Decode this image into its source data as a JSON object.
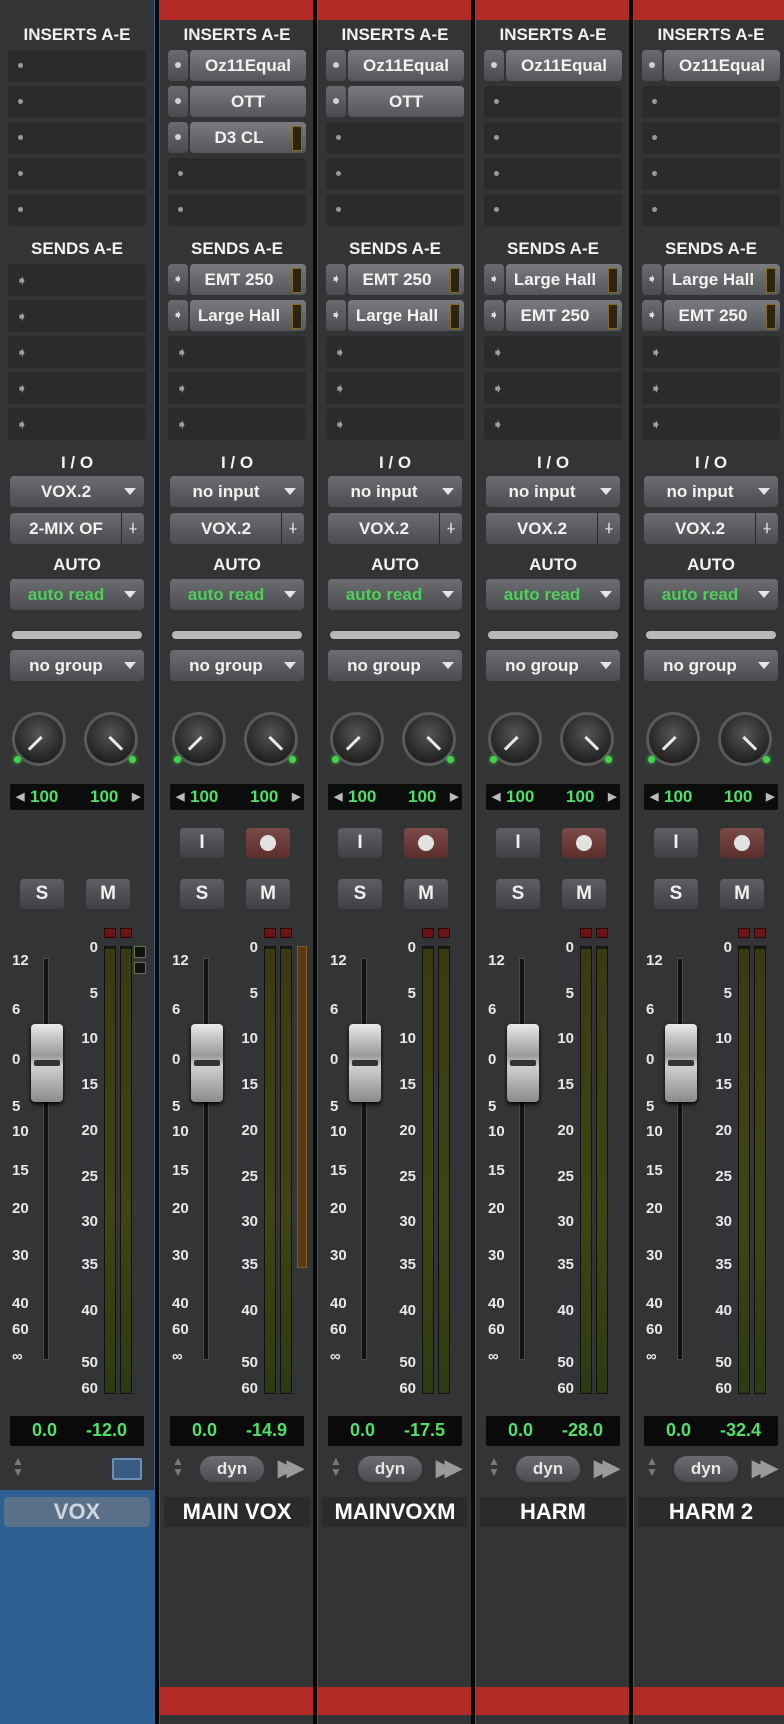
{
  "section_labels": {
    "inserts": "INSERTS A-E",
    "sends": "SENDS A-E",
    "io": "I / O",
    "auto": "AUTO"
  },
  "button_labels": {
    "solo": "S",
    "mute": "M",
    "input": "I"
  },
  "fader_scale": [
    "12",
    "6",
    "0",
    "5",
    "10",
    "15",
    "20",
    "30",
    "40",
    "60",
    "∞"
  ],
  "meter_scale": [
    "0",
    "5",
    "10",
    "15",
    "20",
    "25",
    "30",
    "35",
    "40",
    "50",
    "60"
  ],
  "colors": {
    "track_red": "#b42a24",
    "folder_blue": "#2e5f92",
    "readout_green": "#4fe06a",
    "auto_green": "#4fce5a"
  },
  "icons": {
    "folder": "folder-icon",
    "fast_forward": "fast-forward-icon",
    "up_down": "up-down-arrows-icon",
    "send_arrow": "send-arrow-icon"
  },
  "tracks": [
    {
      "name": "VOX",
      "type": "folder",
      "inserts": [],
      "sends": [],
      "io_input": "VOX.2",
      "io_output": "2-MIX OF",
      "automation": "auto read",
      "group": "no group",
      "pan_left": "100",
      "pan_right": "100",
      "volume": "0.0",
      "peak": "-12.0"
    },
    {
      "name": "MAIN VOX",
      "type": "audio",
      "inserts": [
        "Oz11Equal",
        "OTT",
        "D3 CL"
      ],
      "sends": [
        "EMT 250",
        "Large Hall"
      ],
      "io_input": "no input",
      "io_output": "VOX.2",
      "automation": "auto read",
      "group": "no group",
      "pan_left": "100",
      "pan_right": "100",
      "volume": "0.0",
      "peak": "-14.9",
      "dyn": "dyn"
    },
    {
      "name": "MAINVOXM",
      "type": "audio",
      "inserts": [
        "Oz11Equal",
        "OTT"
      ],
      "sends": [
        "EMT 250",
        "Large Hall"
      ],
      "io_input": "no input",
      "io_output": "VOX.2",
      "automation": "auto read",
      "group": "no group",
      "pan_left": "100",
      "pan_right": "100",
      "volume": "0.0",
      "peak": "-17.5",
      "dyn": "dyn"
    },
    {
      "name": "HARM",
      "type": "audio",
      "inserts": [
        "Oz11Equal"
      ],
      "sends": [
        "Large Hall",
        "EMT 250"
      ],
      "io_input": "no input",
      "io_output": "VOX.2",
      "automation": "auto read",
      "group": "no group",
      "pan_left": "100",
      "pan_right": "100",
      "volume": "0.0",
      "peak": "-28.0",
      "dyn": "dyn"
    },
    {
      "name": "HARM 2",
      "type": "audio",
      "inserts": [
        "Oz11Equal"
      ],
      "sends": [
        "Large Hall",
        "EMT 250"
      ],
      "io_input": "no input",
      "io_output": "VOX.2",
      "automation": "auto read",
      "group": "no group",
      "pan_left": "100",
      "pan_right": "100",
      "volume": "0.0",
      "peak": "-32.4",
      "dyn": "dyn"
    }
  ]
}
